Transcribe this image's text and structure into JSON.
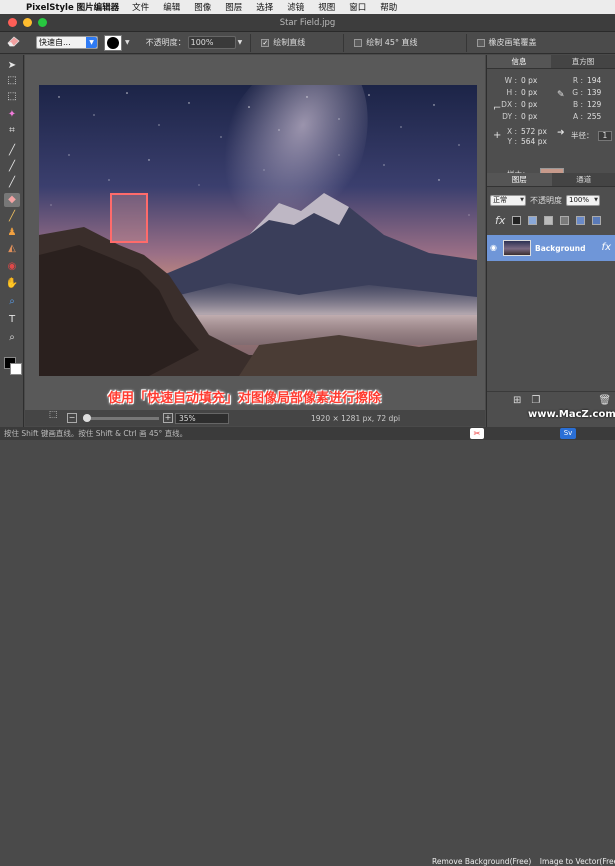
{
  "menubar": {
    "app_name": "PixelStyle 图片编辑器",
    "items": [
      "文件",
      "编辑",
      "图像",
      "图层",
      "选择",
      "滤镜",
      "视图",
      "窗口",
      "帮助"
    ]
  },
  "window": {
    "title": "Star Field.jpg"
  },
  "toolbar": {
    "mode_select": "快速自...",
    "opacity_label": "不透明度：",
    "opacity_value": "100%",
    "draw_line_label": "绘制直线",
    "draw_45_label": "绘制 45° 直线",
    "eraser_label": "橡皮画笔覆盖"
  },
  "info_panel": {
    "tabs": [
      "信息",
      "直方图"
    ],
    "w": "0 px",
    "h": "0 px",
    "dx": "0 px",
    "dy": "0 px",
    "r": "194",
    "g": "139",
    "b": "129",
    "a": "255",
    "x": "572 px",
    "y": "564 px",
    "radius_label": "半径：",
    "radius_value": "1",
    "sample_label": "样本：",
    "sample_color": "#c79a8b"
  },
  "layers_panel": {
    "tabs": [
      "图层",
      "通道"
    ],
    "blend_mode": "正常",
    "opacity_label": "不透明度",
    "opacity_value": "100%",
    "layer_name": "Background"
  },
  "canvas": {
    "caption": "使用「快速自动填充」对图像局部像素进行擦除",
    "dimensions": "1920 × 1281 px, 72 dpi",
    "zoom": "35%"
  },
  "statusbar": {
    "hint": "按住 Shift 键画直线。按住 Shift & Ctrl 画 45° 直线。",
    "remove_bg": "Remove Background(Free)",
    "image_to_vector": "Image to Vector(Free)"
  },
  "watermark": "www.MacZ.com",
  "colors": {
    "accent": "#2f7bf4",
    "layer_selected": "#6f96d8",
    "caption": "#ff3b30",
    "fg_swatch": "#000000",
    "bg_swatch": "#ffffff"
  }
}
